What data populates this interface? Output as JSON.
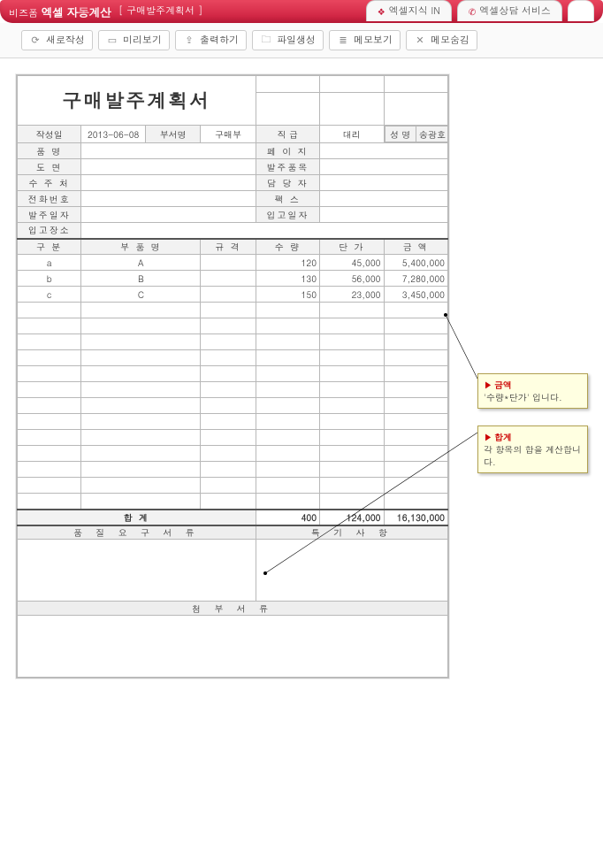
{
  "header": {
    "brand_prefix": "비즈폼",
    "brand_main": "엑셀 자동계산",
    "doc_tag": "[ 구매발주계획서 ]",
    "tabs": [
      {
        "icon": "bulb-icon",
        "label": "엑셀지식 IN"
      },
      {
        "icon": "phone-icon",
        "label": "엑셀상담 서비스"
      }
    ]
  },
  "toolbar": [
    {
      "icon": "⟳",
      "name": "new-button",
      "label": "새로작성"
    },
    {
      "icon": "▭",
      "name": "preview-button",
      "label": "미리보기"
    },
    {
      "icon": "⇪",
      "name": "print-button",
      "label": "출력하기"
    },
    {
      "icon": "🗀",
      "name": "filegen-button",
      "label": "파일생성"
    },
    {
      "icon": "≣",
      "name": "memoview-button",
      "label": "메모보기"
    },
    {
      "icon": "✕",
      "name": "memohide-button",
      "label": "메모숨김"
    }
  ],
  "doc": {
    "title": "구매발주계획서",
    "meta": {
      "date_label": "작성일",
      "date_value": "2013-06-08",
      "dept_label": "부서명",
      "dept_value": "구매부",
      "rank_label": "직   급",
      "rank_value": "대리",
      "name_label": "성    명",
      "name_value": "송광호"
    },
    "info_left": [
      "품    명",
      "도    면",
      "수 주 처",
      "전화번호",
      "발주일자",
      "입고장소"
    ],
    "info_right": [
      "페 이 지",
      "발주품목",
      "담 당 자",
      "팩    스",
      "입고일자"
    ],
    "cols": [
      "구    분",
      "부 품 명",
      "규    격",
      "수    량",
      "단    가",
      "금    액"
    ],
    "rows": [
      {
        "gubun": "a",
        "part": "A",
        "spec": "",
        "qty": "120",
        "price": "45,000",
        "amount": "5,400,000"
      },
      {
        "gubun": "b",
        "part": "B",
        "spec": "",
        "qty": "130",
        "price": "56,000",
        "amount": "7,280,000"
      },
      {
        "gubun": "c",
        "part": "C",
        "spec": "",
        "qty": "150",
        "price": "23,000",
        "amount": "3,450,000"
      }
    ],
    "blank_rows": 13,
    "sum": {
      "label": "합                            계",
      "qty": "400",
      "price": "124,000",
      "amount": "16,130,000"
    },
    "sections": {
      "quality": "품 질 요 구 서 류",
      "special": "특 기 사 항",
      "attach": "첨    부    서    류"
    }
  },
  "notes": {
    "n1": {
      "title": "금액",
      "body": "'수량*단가' 입니다."
    },
    "n2": {
      "title": "합계",
      "body": "각 항목의 합을 계산합니다."
    }
  }
}
